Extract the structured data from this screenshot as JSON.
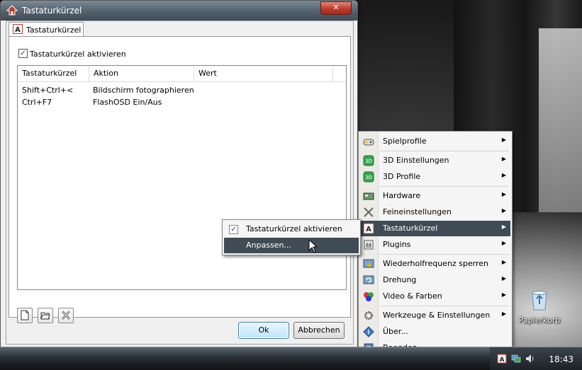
{
  "window": {
    "title": "Tastaturkürzel",
    "close_label": "✕",
    "tab_label": "Tastaturkürzel",
    "enable_checkbox_label": "Tastaturkürzel aktivieren",
    "enable_checked": true,
    "columns": [
      "Tastaturkürzel",
      "Aktion",
      "Wert"
    ],
    "rows": [
      {
        "shortcut": "Shift+Ctrl+<",
        "action": "Bildschirm fotographieren",
        "value": ""
      },
      {
        "shortcut": "Ctrl+F7",
        "action": "FlashOSD Ein/Aus",
        "value": ""
      }
    ],
    "ok_label": "Ok",
    "cancel_label": "Abbrechen"
  },
  "tray_menu": {
    "items": [
      {
        "label": "Spielprofile",
        "icon": "gamepad-icon",
        "submenu": true
      },
      {
        "label": "3D Einstellungen",
        "icon": "3d-icon",
        "submenu": true
      },
      {
        "label": "3D Profile",
        "icon": "3d-profile-icon",
        "submenu": true
      },
      {
        "label": "Hardware",
        "icon": "hardware-icon",
        "submenu": true
      },
      {
        "label": "Feineinstellungen",
        "icon": "tools-icon",
        "submenu": true
      },
      {
        "label": "Tastaturkürzel",
        "icon": "keyboard-shortcut-icon",
        "submenu": true,
        "selected": true
      },
      {
        "label": "Plugins",
        "icon": "plugin-icon",
        "submenu": true
      },
      {
        "label": "Wiederholfrequenz sperren",
        "icon": "refresh-lock-icon",
        "submenu": true
      },
      {
        "label": "Drehung",
        "icon": "rotation-icon",
        "submenu": true
      },
      {
        "label": "Video & Farben",
        "icon": "color-circles-icon",
        "submenu": true
      },
      {
        "label": "Werkzeuge & Einstellungen",
        "icon": "gear-icon",
        "submenu": true
      },
      {
        "label": "Über...",
        "icon": "info-icon",
        "submenu": false
      },
      {
        "label": "Beenden",
        "icon": "exit-icon",
        "submenu": false
      }
    ]
  },
  "submenu": {
    "items": [
      {
        "label": "Tastaturkürzel aktivieren",
        "checked": true
      },
      {
        "label": "Anpassen...",
        "selected": true
      }
    ]
  },
  "desktop": {
    "recycle_bin_label": "Papierkorb"
  },
  "taskbar": {
    "clock": "18:43"
  },
  "colors": {
    "menu_highlight": "#3f4c55",
    "checkbox_check": "#1a3d9a"
  }
}
